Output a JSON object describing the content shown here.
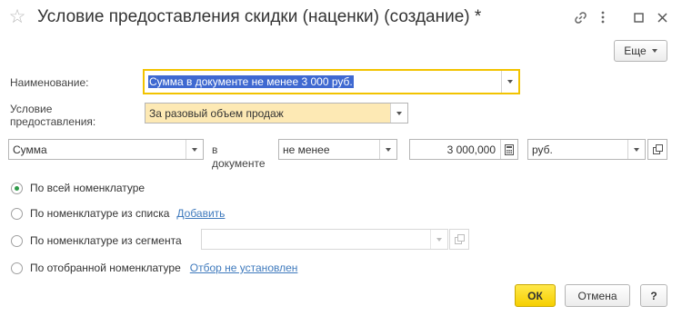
{
  "window": {
    "title": "Условие предоставления скидки (наценки) (создание) *"
  },
  "toolbar": {
    "more_label": "Еще"
  },
  "form": {
    "name_label": "Наименование:",
    "name_value": "Сумма в документе не менее 3 000 руб.",
    "condition_label_line1": "Условие",
    "condition_label_line2": "предоставления:",
    "condition_value": "За разовый объем продаж",
    "criterion_value": "Сумма",
    "in_doc_line1": "в",
    "in_doc_line2": "документе",
    "comparison_value": "не менее",
    "amount_value": "3 000,000",
    "currency_value": "руб."
  },
  "options": [
    {
      "label": "По всей номенклатуре",
      "selected": true
    },
    {
      "label": "По номенклатуре из списка",
      "link": "Добавить",
      "selected": false
    },
    {
      "label": "По номенклатуре из сегмента",
      "selected": false
    },
    {
      "label": "По отобранной номенклатуре",
      "link": "Отбор не установлен",
      "selected": false
    }
  ],
  "footer": {
    "ok_label": "ОК",
    "cancel_label": "Отмена",
    "help_label": "?"
  },
  "colors": {
    "accent_yellow": "#f6cf00",
    "focus_border": "#f2c300",
    "link": "#3f7abd",
    "radio_selected": "#2f9a49",
    "selection": "#3f69d1"
  },
  "icons": {
    "star": "star-icon",
    "link": "link-icon",
    "menu": "more-vertical-icon",
    "maximize": "maximize-icon",
    "close": "close-icon",
    "calculator": "calculator-icon",
    "open": "open-icon"
  }
}
